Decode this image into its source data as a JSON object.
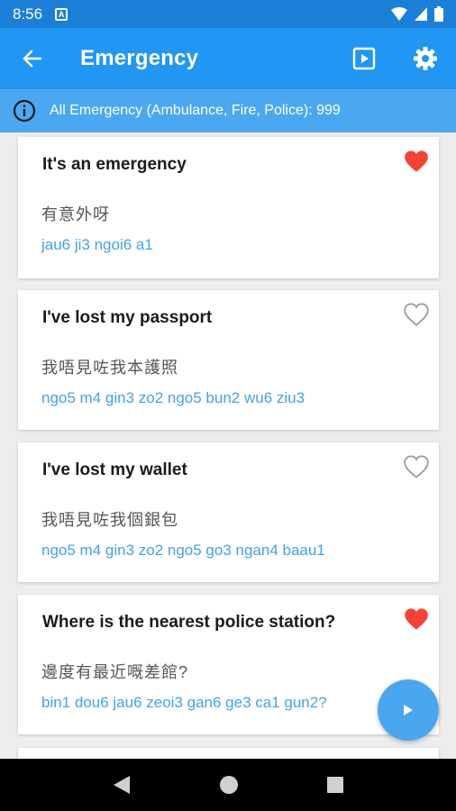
{
  "status_bar": {
    "time": "8:56",
    "notification_glyph": "A"
  },
  "app_bar": {
    "title": "Emergency"
  },
  "info_bar": {
    "text": "All Emergency (Ambulance, Fire, Police): 999"
  },
  "colors": {
    "primary": "#2196f3",
    "status_bar": "#1b7fd8",
    "info_bar": "#4ba8f0",
    "jyutping": "#45a1ea",
    "favorite": "#f44336",
    "fab": "#4aa6f0"
  },
  "phrases": [
    {
      "english": "It's an emergency",
      "chinese": "有意外呀",
      "jyutping": "jau6 ji3 ngoi6 a1",
      "favorite": true
    },
    {
      "english": "I've lost my passport",
      "chinese": "我唔見咗我本護照",
      "jyutping": "ngo5 m4 gin3 zo2 ngo5 bun2 wu6 ziu3",
      "favorite": false
    },
    {
      "english": "I've lost my wallet",
      "chinese": "我唔見咗我個銀包",
      "jyutping": "ngo5 m4 gin3 zo2 ngo5 go3 ngan4 baau1",
      "favorite": false
    },
    {
      "english": "Where is the nearest police station?",
      "chinese": "邊度有最近嘅差館?",
      "jyutping": "bin1 dou6 jau6 zeoi3 gan6 ge3 ca1 gun2?",
      "favorite": true
    }
  ],
  "icons": {
    "back": "arrow-back-icon",
    "slideshow": "slideshow-icon",
    "settings": "gear-icon",
    "info": "info-icon",
    "favorite": "heart-icon",
    "play": "play-icon",
    "nav_back": "triangle-back-icon",
    "nav_home": "circle-home-icon",
    "nav_recents": "square-recents-icon"
  }
}
